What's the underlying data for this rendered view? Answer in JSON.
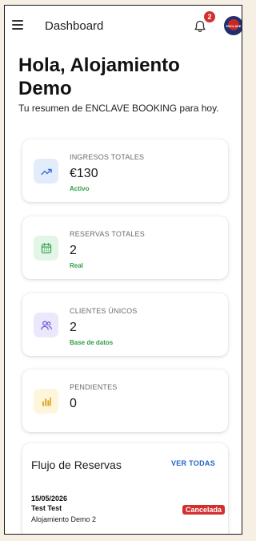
{
  "header": {
    "title": "Dashboard",
    "notification_count": "2",
    "menu_icon": "menu-icon",
    "bell_icon": "bell-icon",
    "avatar_text": "ENCLAVE"
  },
  "greeting": {
    "title": "Hola, Alojamiento Demo",
    "subtitle": "Tu resumen de ENCLAVE BOOKING para hoy."
  },
  "stats": [
    {
      "label": "INGRESOS TOTALES",
      "value": "€130",
      "note": "Activo",
      "icon": "trending-up-icon",
      "icon_bg": "#e3ecfb",
      "icon_color": "#3b6fd8"
    },
    {
      "label": "RESERVAS TOTALES",
      "value": "2",
      "note": "Real",
      "icon": "calendar-icon",
      "icon_bg": "#e3f5e6",
      "icon_color": "#3aa657"
    },
    {
      "label": "CLIENTES ÚNICOS",
      "value": "2",
      "note": "Base de datos",
      "icon": "users-icon",
      "icon_bg": "#ece8fb",
      "icon_color": "#7062d8"
    },
    {
      "label": "PENDIENTES",
      "value": "0",
      "note": "",
      "icon": "bar-chart-icon",
      "icon_bg": "#fdf5dc",
      "icon_color": "#e0a524"
    }
  ],
  "bookings": {
    "title": "Flujo de Reservas",
    "view_all": "VER TODAS",
    "rows": [
      {
        "date": "15/05/2026",
        "guest": "Test Test",
        "property": "Alojamiento Demo 2",
        "status": "Cancelada",
        "status_color": "#d32f2f"
      }
    ]
  },
  "colors": {
    "accent": "#1e63c8",
    "success": "#2e9e44",
    "danger": "#d32f2f"
  }
}
